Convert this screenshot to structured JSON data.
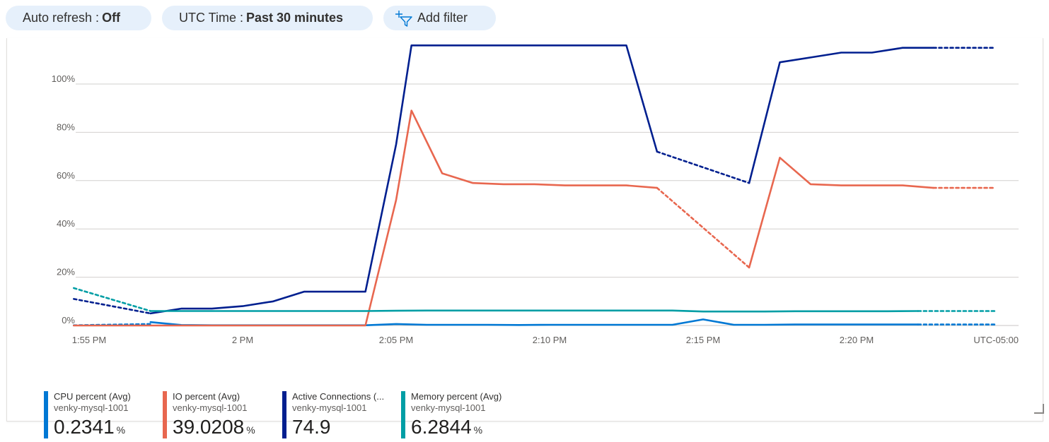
{
  "toolbar": {
    "auto_refresh_label": "Auto refresh :",
    "auto_refresh_value": "Off",
    "time_label": "UTC Time :",
    "time_value": "Past 30 minutes",
    "add_filter_label": "Add filter",
    "add_filter_icon": "add-filter-icon"
  },
  "chart_data": {
    "type": "line",
    "ylim": [
      0,
      120
    ],
    "y_ticks": [
      "0%",
      "20%",
      "40%",
      "60%",
      "80%",
      "100%"
    ],
    "y_tick_values": [
      0,
      20,
      40,
      60,
      80,
      100
    ],
    "x_ticks": [
      "1:55 PM",
      "2 PM",
      "2:05 PM",
      "2:10 PM",
      "2:15 PM",
      "2:20 PM"
    ],
    "x_tick_minutes": [
      0,
      5,
      10,
      15,
      20,
      25
    ],
    "timezone_label": "UTC-05:00",
    "grid": true,
    "x_unit": "minutes after 1:55 PM",
    "series": [
      {
        "name": "CPU percent (Avg)",
        "color": "#0078d4",
        "dashed_segments": [
          [
            -0.5,
            2,
            0.1,
            0.6
          ]
        ],
        "solid": [
          [
            2,
            1.4
          ],
          [
            3,
            0.2
          ],
          [
            4,
            0.1
          ],
          [
            5,
            0.1
          ],
          [
            6,
            0.1
          ],
          [
            7,
            0.1
          ],
          [
            8,
            0.1
          ],
          [
            9,
            0.1
          ],
          [
            10,
            0.6
          ],
          [
            11,
            0.3
          ],
          [
            12,
            0.3
          ],
          [
            13,
            0.3
          ],
          [
            14,
            0.2
          ],
          [
            15,
            0.3
          ],
          [
            16,
            0.3
          ],
          [
            17,
            0.3
          ],
          [
            18,
            0.3
          ],
          [
            19,
            0.3
          ],
          [
            20,
            2.5
          ],
          [
            21,
            0.3
          ],
          [
            22,
            0.3
          ],
          [
            23,
            0.4
          ],
          [
            24,
            0.4
          ],
          [
            25,
            0.4
          ],
          [
            26,
            0.4
          ],
          [
            27,
            0.4
          ]
        ],
        "tail": [
          [
            27,
            0.4
          ],
          [
            29.5,
            0.4
          ]
        ],
        "legend_name": "CPU percent (Avg)",
        "resource": "venky-mysql-1001",
        "value": "0.2341",
        "unit": "%"
      },
      {
        "name": "IO percent (Avg)",
        "color": "#e8674f",
        "solid": [
          [
            -0.5,
            0
          ],
          [
            9,
            0
          ],
          [
            10,
            52
          ],
          [
            10.5,
            89
          ],
          [
            11.5,
            63
          ],
          [
            12.5,
            59
          ],
          [
            13.5,
            58.5
          ],
          [
            14.5,
            58.5
          ],
          [
            15.5,
            58
          ],
          [
            16.5,
            58
          ],
          [
            17.5,
            58
          ],
          [
            18.5,
            57
          ]
        ],
        "gap": [
          [
            18.5,
            57
          ],
          [
            21.5,
            24
          ]
        ],
        "solid2": [
          [
            21.5,
            24
          ],
          [
            22.5,
            69.5
          ],
          [
            23.5,
            58.5
          ],
          [
            24.5,
            58
          ],
          [
            25.5,
            58
          ],
          [
            26.5,
            58
          ],
          [
            27.5,
            57
          ]
        ],
        "tail": [
          [
            27.5,
            57
          ],
          [
            29.5,
            57
          ]
        ],
        "legend_name": "IO percent (Avg)",
        "resource": "venky-mysql-1001",
        "value": "39.0208",
        "unit": "%"
      },
      {
        "name": "Active Connections",
        "color": "#001f8f",
        "head": [
          [
            -0.5,
            11
          ],
          [
            2,
            5
          ]
        ],
        "solid": [
          [
            2,
            5
          ],
          [
            3,
            7
          ],
          [
            4,
            7
          ],
          [
            5,
            8
          ],
          [
            6,
            10
          ],
          [
            7,
            14
          ],
          [
            8,
            14
          ],
          [
            9,
            14
          ],
          [
            10,
            75
          ],
          [
            10.5,
            116
          ],
          [
            11.5,
            116
          ],
          [
            12.5,
            116
          ],
          [
            13.5,
            116
          ],
          [
            14.5,
            116
          ],
          [
            15.5,
            116
          ],
          [
            16.5,
            116
          ],
          [
            17.5,
            116
          ],
          [
            18.5,
            72
          ]
        ],
        "gap": [
          [
            18.5,
            72
          ],
          [
            21.5,
            59
          ]
        ],
        "solid2": [
          [
            21.5,
            59
          ],
          [
            22.5,
            109
          ],
          [
            23.5,
            111
          ],
          [
            24.5,
            113
          ],
          [
            25.5,
            113
          ],
          [
            26.5,
            115
          ],
          [
            27.5,
            115
          ]
        ],
        "tail": [
          [
            27.5,
            115
          ],
          [
            29.5,
            115
          ]
        ],
        "legend_name": "Active Connections (...",
        "resource": "venky-mysql-1001",
        "value": "74.9",
        "unit": ""
      },
      {
        "name": "Memory percent (Avg)",
        "color": "#009ea5",
        "head": [
          [
            -0.5,
            15.5
          ],
          [
            2,
            6
          ]
        ],
        "solid": [
          [
            2,
            6
          ],
          [
            3,
            6
          ],
          [
            4,
            6
          ],
          [
            5,
            6
          ],
          [
            6,
            6
          ],
          [
            7,
            6
          ],
          [
            8,
            6
          ],
          [
            9,
            6
          ],
          [
            10,
            6.1
          ],
          [
            11,
            6.2
          ],
          [
            12,
            6.2
          ],
          [
            13,
            6.2
          ],
          [
            14,
            6.2
          ],
          [
            15,
            6.2
          ],
          [
            16,
            6.2
          ],
          [
            17,
            6.2
          ],
          [
            18,
            6.2
          ],
          [
            19,
            6.2
          ],
          [
            20,
            5.8
          ],
          [
            21,
            5.8
          ],
          [
            22,
            5.8
          ],
          [
            23,
            5.9
          ],
          [
            24,
            5.9
          ],
          [
            25,
            5.9
          ],
          [
            26,
            5.9
          ],
          [
            27,
            6
          ]
        ],
        "tail": [
          [
            27,
            6
          ],
          [
            29.5,
            6
          ]
        ],
        "legend_name": "Memory percent (Avg)",
        "resource": "venky-mysql-1001",
        "value": "6.2844",
        "unit": "%"
      }
    ]
  }
}
